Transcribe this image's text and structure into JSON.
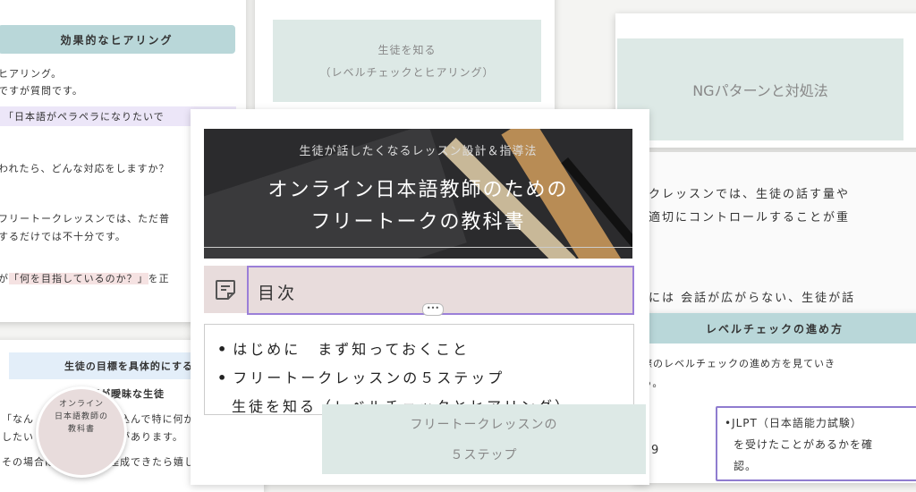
{
  "left_card": {
    "header": "効果的なヒアリング",
    "line1": "ヒアリング。",
    "line2": "ですが質問です。",
    "purple_line": "「日本語がペラペラになりたいで",
    "line3": "われたら、どんな対応をしますか？",
    "line4": "フリートークレッスンでは、ただ普",
    "line5": "するだけでは不十分です。",
    "line6_pre": "が",
    "line6_hl": "「何を目指しているのか？」",
    "line6_post": "を正"
  },
  "left_bottom_card": {
    "header": "生徒の目標を具体的にする質",
    "line1": "標が曖昧な生徒",
    "line2": "「なん　　　スンを申し込んで特に何が",
    "line3": "したい　　　がない場合があります。",
    "line4": "その場合は　　ことが達成できたら嬉しいの"
  },
  "top_center": {
    "line1": "生徒を知る",
    "line2": "（レベルチェックとヒアリング）"
  },
  "right_top": {
    "label": "NGパターンと対処法"
  },
  "right_middle": {
    "line1": "ークレッスンでは、生徒の話す量や",
    "line2": "を適切にコントロールすることが重",
    "line3": "時には 会話が広がらない、生徒が話"
  },
  "right_bottom": {
    "header": "レベルチェックの進め方",
    "line1": "際のレベルチェックの進め方を見ていき",
    "line2": "う。",
    "item1": "•JLPT（日本語能力試験）",
    "item2": "を受けたことがあるかを確",
    "item3": "認。",
    "side": "9"
  },
  "main_card": {
    "subtitle": "生徒が話したくなるレッスン設計＆指導法",
    "title_line1": "オンライン日本語教師のための",
    "title_line2": "フリートークの教科書",
    "toc_title": "目次",
    "toc_dots": "•••",
    "items": [
      "はじめに　まず知っておくこと",
      "フリートークレッスンの５ステップ",
      "生徒を知る（レベルチェックとヒアリング）"
    ]
  },
  "bottom_center": {
    "line1": "フリートークレッスンの",
    "line2": "５ステップ"
  },
  "stamp": {
    "line1": "オンライン",
    "line2": "日本語教師の",
    "line3": "教科書"
  },
  "colors": {
    "teal": "#b9d7d9",
    "mint": "#dde9e6",
    "pink": "#e8dcdc",
    "purple": "#9b7fd8"
  }
}
